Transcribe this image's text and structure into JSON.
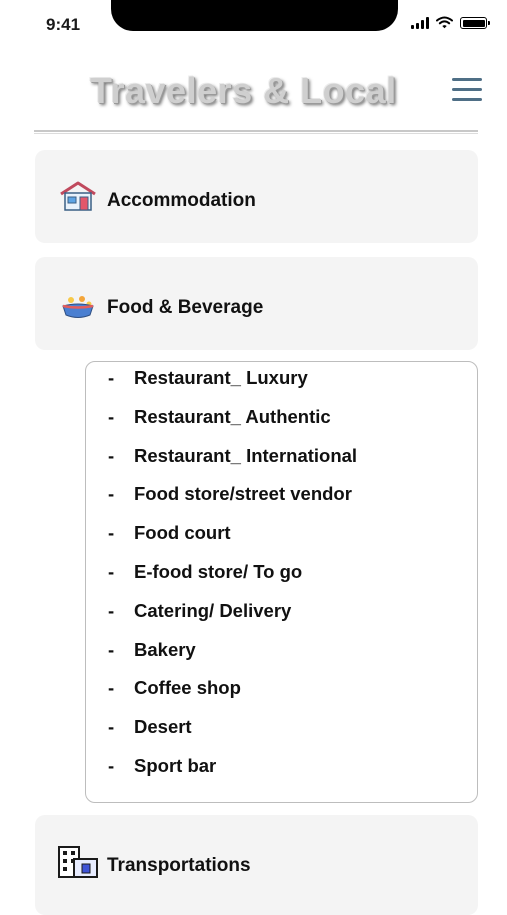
{
  "status": {
    "time": "9:41"
  },
  "header": {
    "title": "Travelers & Local"
  },
  "categories": {
    "accommodation": {
      "label": "Accommodation",
      "icon": "house-icon"
    },
    "food": {
      "label": "Food & Beverage",
      "icon": "food-bowl-icon"
    },
    "transport": {
      "label": "Transportations",
      "icon": "building-icon"
    }
  },
  "food_submenu": {
    "items": [
      "Restaurant_ Luxury",
      "Restaurant_ Authentic",
      "Restaurant_ International",
      "Food store/street vendor",
      "Food court",
      "E-food store/ To go",
      "Catering/ Delivery",
      "Bakery",
      "Coffee shop",
      "Desert",
      "Sport bar"
    ]
  },
  "colors": {
    "menu_icon": "#4f6f86",
    "card_bg": "#f4f4f4"
  }
}
